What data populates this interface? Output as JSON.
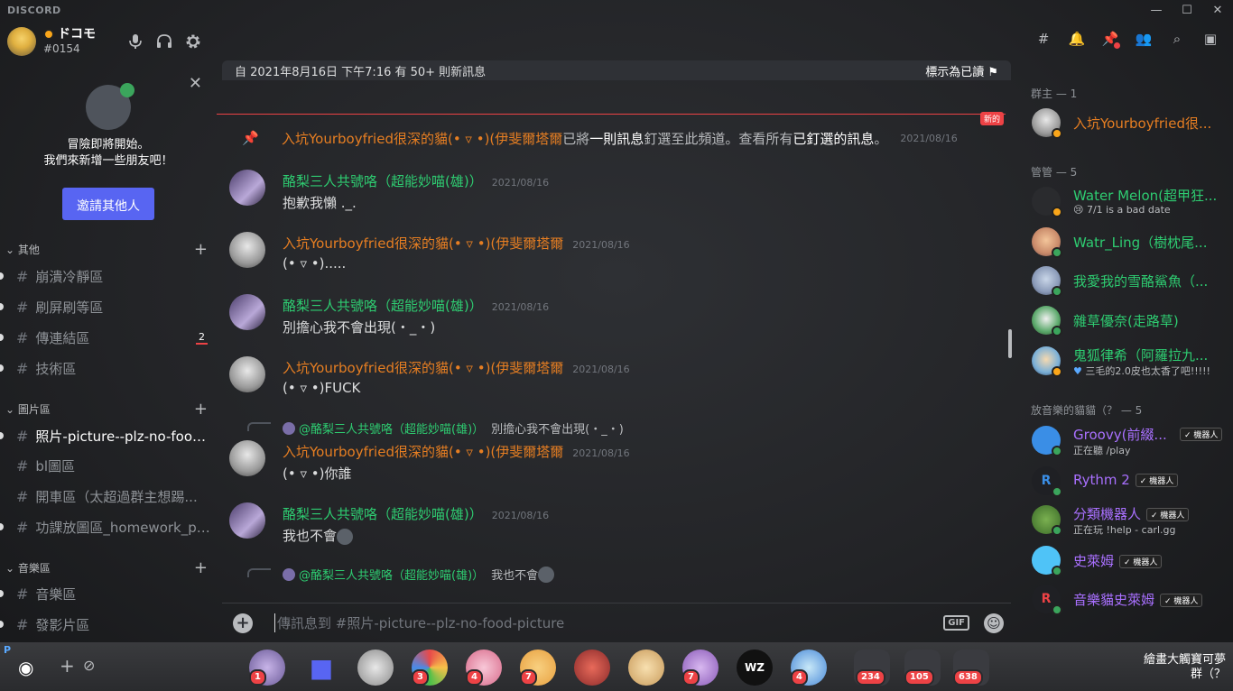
{
  "window": {
    "app_name": "DISCORD",
    "controls": [
      "—",
      "☐",
      "✕"
    ]
  },
  "user": {
    "name": "ドコモ",
    "tag": "#0154"
  },
  "invite": {
    "line1": "冒險即將開始。",
    "line2": "我們來新增一些朋友吧！",
    "button": "邀請其他人"
  },
  "categories": [
    {
      "name": "其他",
      "channels": [
        {
          "label": "崩潰冷靜區"
        },
        {
          "label": "刷屏刷等區"
        },
        {
          "label": "傳連結區",
          "badge": "2"
        },
        {
          "label": "技術區"
        }
      ]
    },
    {
      "name": "圖片區",
      "channels": [
        {
          "label": "照片-picture--plz-no-food-..."
        },
        {
          "label": "bl圖區"
        },
        {
          "label": "開車區（太超過群主想踢..."
        },
        {
          "label": "功課放圖區_homework_pi..."
        }
      ]
    },
    {
      "name": "音樂區",
      "channels": [
        {
          "label": "音樂區"
        },
        {
          "label": "發影片區"
        }
      ]
    }
  ],
  "new_bar": {
    "text": "自 2021年8月16日 下午7:16 有 50+ 則新訊息",
    "mark_read": "標示為已讀"
  },
  "new_tag": "新的",
  "system_message": {
    "author": "入坑Yourboyfried很深的貓(• ▿ •)(伊斐爾塔爾",
    "text1": " 已將",
    "link1": "一則訊息",
    "text2": "釘選至此頻道。查看所有",
    "link2": "已釘選的訊息",
    "text3": "。",
    "time": "2021/08/16"
  },
  "messages": [
    {
      "author": "酪梨三人共號咯（超能妙喵(雄)）",
      "time": "2021/08/16",
      "text": "抱歉我懶 ._."
    },
    {
      "author": "入坑Yourboyfried很深的貓(• ▿ •)(伊斐爾塔爾",
      "time": "2021/08/16",
      "text": "(• ▿ •)....."
    },
    {
      "author": "酪梨三人共號咯（超能妙喵(雄)）",
      "time": "2021/08/16",
      "text": "別擔心我不會出現(・_・)"
    },
    {
      "author": "入坑Yourboyfried很深的貓(• ▿ •)(伊斐爾塔爾",
      "time": "2021/08/16",
      "text": "(• ▿ •)FUCK"
    },
    {
      "reply_to": "@酪梨三人共號咯（超能妙喵(雄)）",
      "reply_text": "別擔心我不會出現(・_・)",
      "author": "入坑Yourboyfried很深的貓(• ▿ •)(伊斐爾塔爾",
      "time": "2021/08/16",
      "text": "(• ▿ •)你誰"
    },
    {
      "author": "酪梨三人共號咯（超能妙喵(雄)）",
      "time": "2021/08/16",
      "text": "我也不會"
    },
    {
      "reply_to": "@酪梨三人共號咯（超能妙喵(雄)）",
      "reply_text": "我也不會"
    }
  ],
  "input": {
    "placeholder": "傳訊息到 #照片-picture--plz-no-food-picture",
    "gif": "GIF"
  },
  "members": {
    "groups": [
      {
        "title": "群主 — 1"
      },
      {
        "title": "管管 — 5"
      },
      {
        "title": "放音樂的貓貓（？ — 5"
      }
    ],
    "owner": {
      "name": "入坑Yourboyfried很..."
    },
    "mods": [
      {
        "name": "Water Melon(超甲狂...",
        "status": "7/1 is a bad date"
      },
      {
        "name": "Watr_Ling（樹枕尾..."
      },
      {
        "name": "我愛我的雪酪鯊魚（..."
      },
      {
        "name": "雜草優奈(走路草)"
      },
      {
        "name": "鬼狐律希（阿羅拉九...",
        "status": "三毛的2.0皮也太香了吧!!!!!"
      }
    ],
    "bots": [
      {
        "name": "Groovy(前綴...",
        "status": "正在聽 /play"
      },
      {
        "name": "Rythm 2"
      },
      {
        "name": "分類機器人",
        "status": "正在玩 !help - carl.gg"
      },
      {
        "name": "史萊姆"
      },
      {
        "name": "音樂貓史萊姆"
      }
    ],
    "bot_tag": "✓ 機器人"
  },
  "taskbar": {
    "badges": [
      "1",
      "3",
      "4",
      "7",
      "7",
      "4",
      "234",
      "105",
      "638"
    ],
    "title_line1": "繪畫大觸寶可夢",
    "title_line2": "群（？"
  },
  "colors": {
    "accent": "#5865f2",
    "orange_name": "#e67e22",
    "green_name": "#2ecc71",
    "bot_name": "#a970ff",
    "unread": "#ed4245"
  }
}
